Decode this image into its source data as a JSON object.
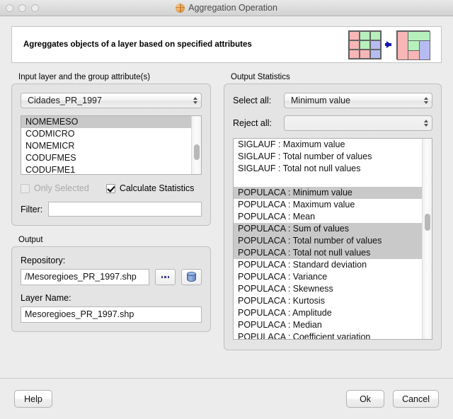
{
  "window": {
    "title": "Aggregation Operation",
    "app_icon": "globe-icon",
    "traffic_lights": [
      "close",
      "minimize",
      "zoom"
    ]
  },
  "banner": {
    "text": "Agreggates objects of a layer based on specified attributes",
    "graphic": "grid-aggregation-diagram",
    "colors": {
      "pink": "#f8b6b6",
      "green": "#b6f0bb",
      "blue": "#b6bcf2",
      "arrow": "#1414b4"
    }
  },
  "input_group": {
    "label": "Input layer and the group attribute(s)",
    "layer_combo": {
      "value": "Cidades_PR_1997",
      "icon": "stepper-icon"
    },
    "attributes": [
      {
        "label": "NOMEMESO",
        "selected": true
      },
      {
        "label": "CODMICRO",
        "selected": false
      },
      {
        "label": "NOMEMICR",
        "selected": false
      },
      {
        "label": "CODUFMES",
        "selected": false
      },
      {
        "label": "CODUFME1",
        "selected": false
      }
    ],
    "only_selected": {
      "label": "Only Selected",
      "checked": false,
      "disabled": true
    },
    "calculate_statistics": {
      "label": "Calculate Statistics",
      "checked": true,
      "disabled": false
    },
    "filter": {
      "label": "Filter:",
      "value": "",
      "placeholder": ""
    }
  },
  "output_group": {
    "label": "Output",
    "repository": {
      "label": "Repository:",
      "value": "/Mesoregioes_PR_1997.shp"
    },
    "browse_button": {
      "label": "...",
      "icon": "ellipsis-icon"
    },
    "database_button": {
      "icon": "database-icon"
    },
    "layer_name": {
      "label": "Layer Name:",
      "value": "Mesoregioes_PR_1997.shp"
    }
  },
  "stats_group": {
    "label": "Output Statistics",
    "select_all": {
      "label": "Select all:",
      "value": "Minimum value"
    },
    "reject_all": {
      "label": "Reject all:",
      "value": ""
    },
    "items": [
      {
        "label": "SIGLAUF : Maximum value",
        "selected": false
      },
      {
        "label": "SIGLAUF : Total number of values",
        "selected": false
      },
      {
        "label": "SIGLAUF : Total not null values",
        "selected": false
      },
      {
        "label": "",
        "selected": false
      },
      {
        "label": "POPULACA : Minimum value",
        "selected": true
      },
      {
        "label": "POPULACA : Maximum value",
        "selected": false
      },
      {
        "label": "POPULACA : Mean",
        "selected": false
      },
      {
        "label": "POPULACA : Sum of values",
        "selected": true
      },
      {
        "label": "POPULACA : Total number of values",
        "selected": true
      },
      {
        "label": "POPULACA : Total not null values",
        "selected": true
      },
      {
        "label": "POPULACA : Standard deviation",
        "selected": false
      },
      {
        "label": "POPULACA : Variance",
        "selected": false
      },
      {
        "label": "POPULACA : Skewness",
        "selected": false
      },
      {
        "label": "POPULACA : Kurtosis",
        "selected": false
      },
      {
        "label": "POPULACA : Amplitude",
        "selected": false
      },
      {
        "label": "POPULACA : Median",
        "selected": false
      },
      {
        "label": "POPULACA : Coefficient variation",
        "selected": false
      }
    ]
  },
  "footer": {
    "help": "Help",
    "ok": "Ok",
    "cancel": "Cancel"
  }
}
